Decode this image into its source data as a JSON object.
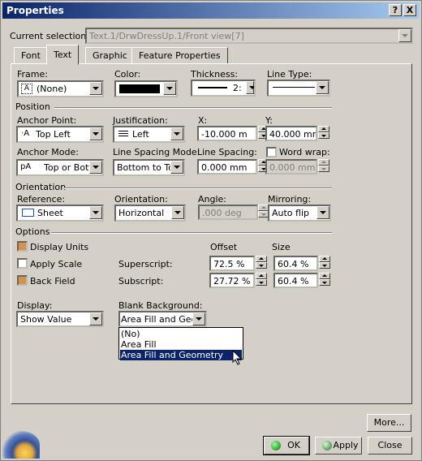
{
  "window": {
    "title": "Properties",
    "help_glyph": "?",
    "close_glyph": "X"
  },
  "current_selection": {
    "label": "Current selection :",
    "value": "Text.1/DrwDressUp.1/Front view[7]"
  },
  "tabs": [
    {
      "label": "Font"
    },
    {
      "label": "Text",
      "active": true
    },
    {
      "label": "Graphic"
    },
    {
      "label": "Feature Properties"
    }
  ],
  "frame": {
    "label": "Frame:",
    "value": "(None)"
  },
  "color": {
    "label": "Color:",
    "value_hex": "#000000"
  },
  "thickness": {
    "label": "Thickness:",
    "value": "2:"
  },
  "line_type": {
    "label": "Line Type:"
  },
  "position": {
    "title": "Position",
    "anchor_point": {
      "label": "Anchor Point:",
      "value": "Top Left"
    },
    "justification": {
      "label": "Justification:",
      "value": "Left"
    },
    "x": {
      "label": "X:",
      "value": "-10.000 m"
    },
    "y": {
      "label": "Y:",
      "value": "40.000 mm"
    },
    "anchor_mode": {
      "label": "Anchor Mode:",
      "value": "Top or Botto"
    },
    "line_spacing_mode": {
      "label": "Line Spacing Mode:",
      "value": "Bottom to Top"
    },
    "line_spacing": {
      "label": "Line Spacing:",
      "value": "0.000 mm"
    },
    "word_wrap": {
      "label": "Word wrap:",
      "checked": false,
      "value": "0.000 mm"
    }
  },
  "orientation": {
    "title": "Orientation",
    "reference": {
      "label": "Reference:",
      "value": "Sheet"
    },
    "orientation": {
      "label": "Orientation:",
      "value": "Horizontal"
    },
    "angle": {
      "label": "Angle:",
      "value": ".000 deg"
    },
    "mirroring": {
      "label": "Mirroring:",
      "value": "Auto flip"
    }
  },
  "options": {
    "title": "Options",
    "display_units": {
      "label": "Display Units",
      "checked": true
    },
    "apply_scale": {
      "label": "Apply Scale",
      "checked": false
    },
    "back_field": {
      "label": "Back Field",
      "checked": true
    },
    "offset_header": "Offset",
    "size_header": "Size",
    "superscript": {
      "label": "Superscript:",
      "offset": "72.5 %",
      "size": "60.4 %"
    },
    "subscript": {
      "label": "Subscript:",
      "offset": "27.72 %",
      "size": "60.4 %"
    }
  },
  "display": {
    "label": "Display:",
    "value": "Show Value"
  },
  "blank_background": {
    "label": "Blank Background:",
    "value": "Area Fill and Geom",
    "options": [
      "(No)",
      "Area Fill",
      "Area Fill and Geometry"
    ],
    "highlighted_index": 2
  },
  "buttons": {
    "more": "More...",
    "ok": "OK",
    "apply": "Apply",
    "close": "Close"
  }
}
